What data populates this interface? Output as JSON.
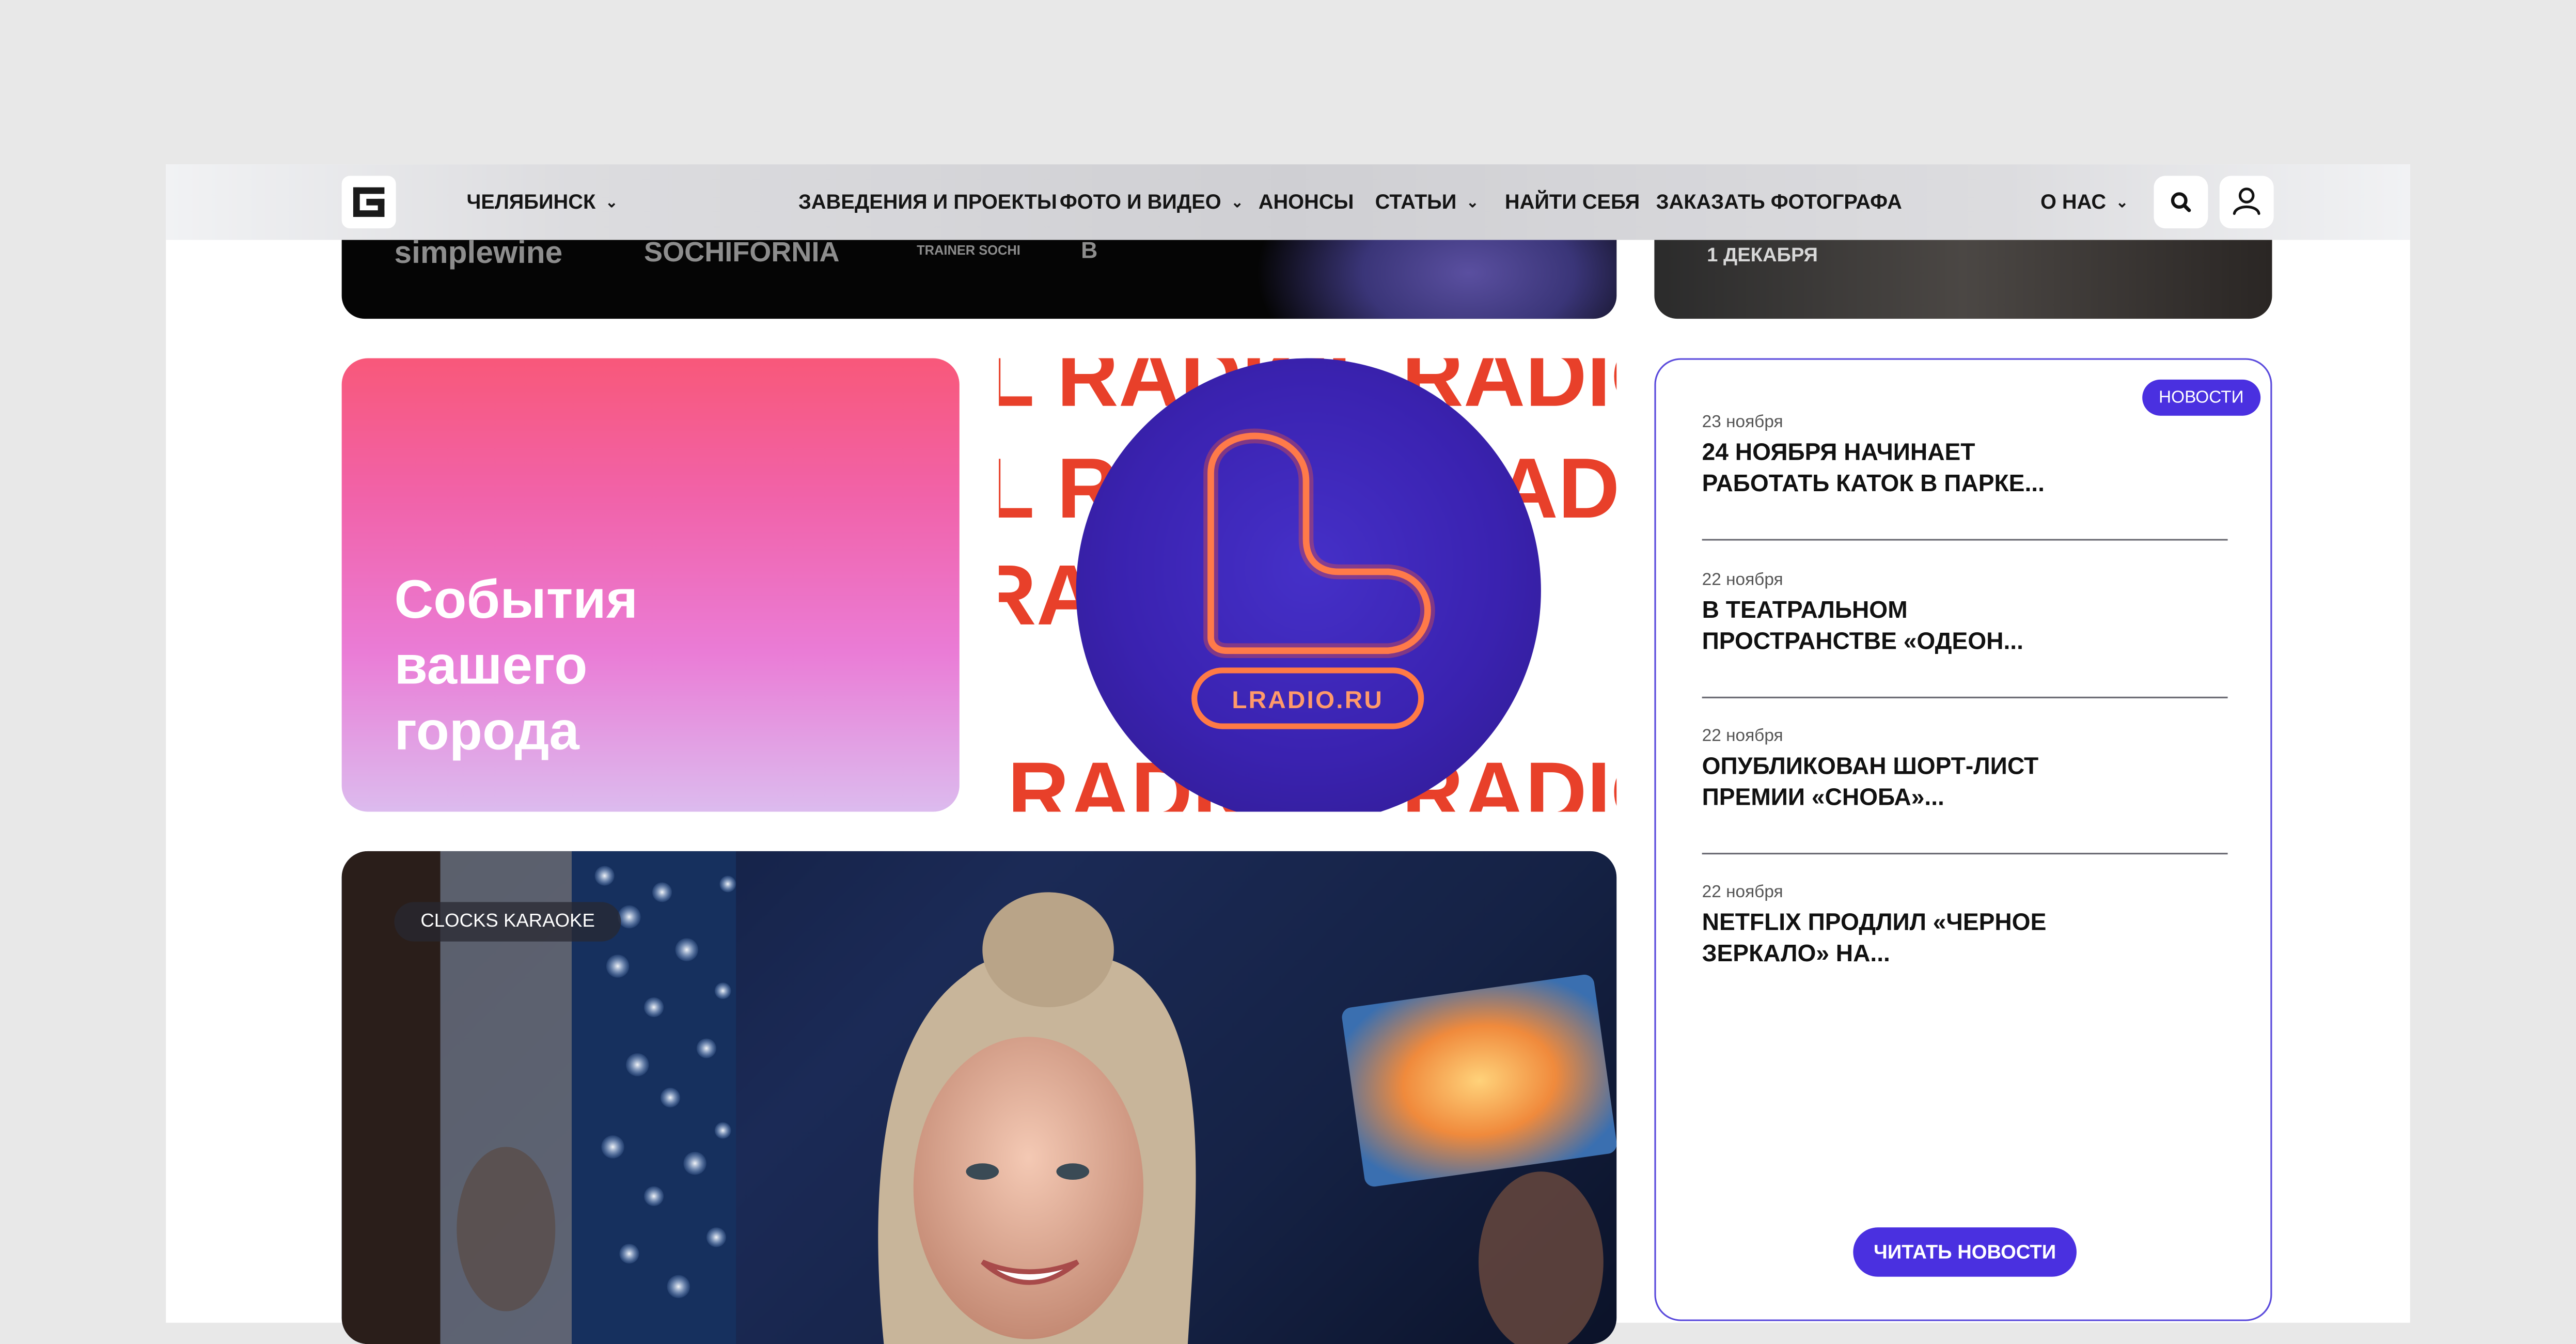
{
  "header": {
    "city": "ЧЕЛЯБИНСК",
    "nav": [
      "ЗАВЕДЕНИЯ И ПРОЕКТЫ",
      "ФОТО И ВИДЕО",
      "АНОНСЫ",
      "СТАТЬИ",
      "НАЙТИ СЕБЯ",
      "ЗАКАЗАТЬ ФОТОГРАФА"
    ],
    "about": "О НАС",
    "chevron": "chevron-down-icon",
    "search_icon": "search-icon",
    "user_icon": "user-icon",
    "logo_icon": "logo-g-icon"
  },
  "top_strip": {
    "brands": [
      "simplewine",
      "SOCHIFORNIA",
      "TRAINER SOCHI",
      "B"
    ],
    "date": "1 ДЕКАБРЯ"
  },
  "promo": {
    "title": "События вашего города"
  },
  "radio_ad": {
    "logo_text": "LRADIO.RU",
    "background_text": "L RADIO"
  },
  "photo_card": {
    "badge": "CLOCKS KARAOKE"
  },
  "news": {
    "tag": "НОВОСТИ",
    "items": [
      {
        "date": "23 ноября",
        "title": "24 НОЯБРЯ НАЧИНАЕТ РАБОТАТЬ КАТОК В ПАРКЕ..."
      },
      {
        "date": "22 ноября",
        "title": "В ТЕАТРАЛЬНОМ ПРОСТРАНСТВЕ «ОДЕОН..."
      },
      {
        "date": "22 ноября",
        "title": "ОПУБЛИКОВАН ШОРТ-ЛИСТ ПРЕМИИ «СНОБА»..."
      },
      {
        "date": "22 ноября",
        "title": "NETFLIX ПРОДЛИЛ «ЧЕРНОЕ ЗЕРКАЛО» НА..."
      }
    ],
    "read_button": "ЧИТАТЬ НОВОСТИ"
  },
  "colors": {
    "accent": "#4a30e0",
    "pink_top": "#f8587a",
    "pink_bottom": "#dcbbee",
    "radio_orange": "#e8402a"
  }
}
